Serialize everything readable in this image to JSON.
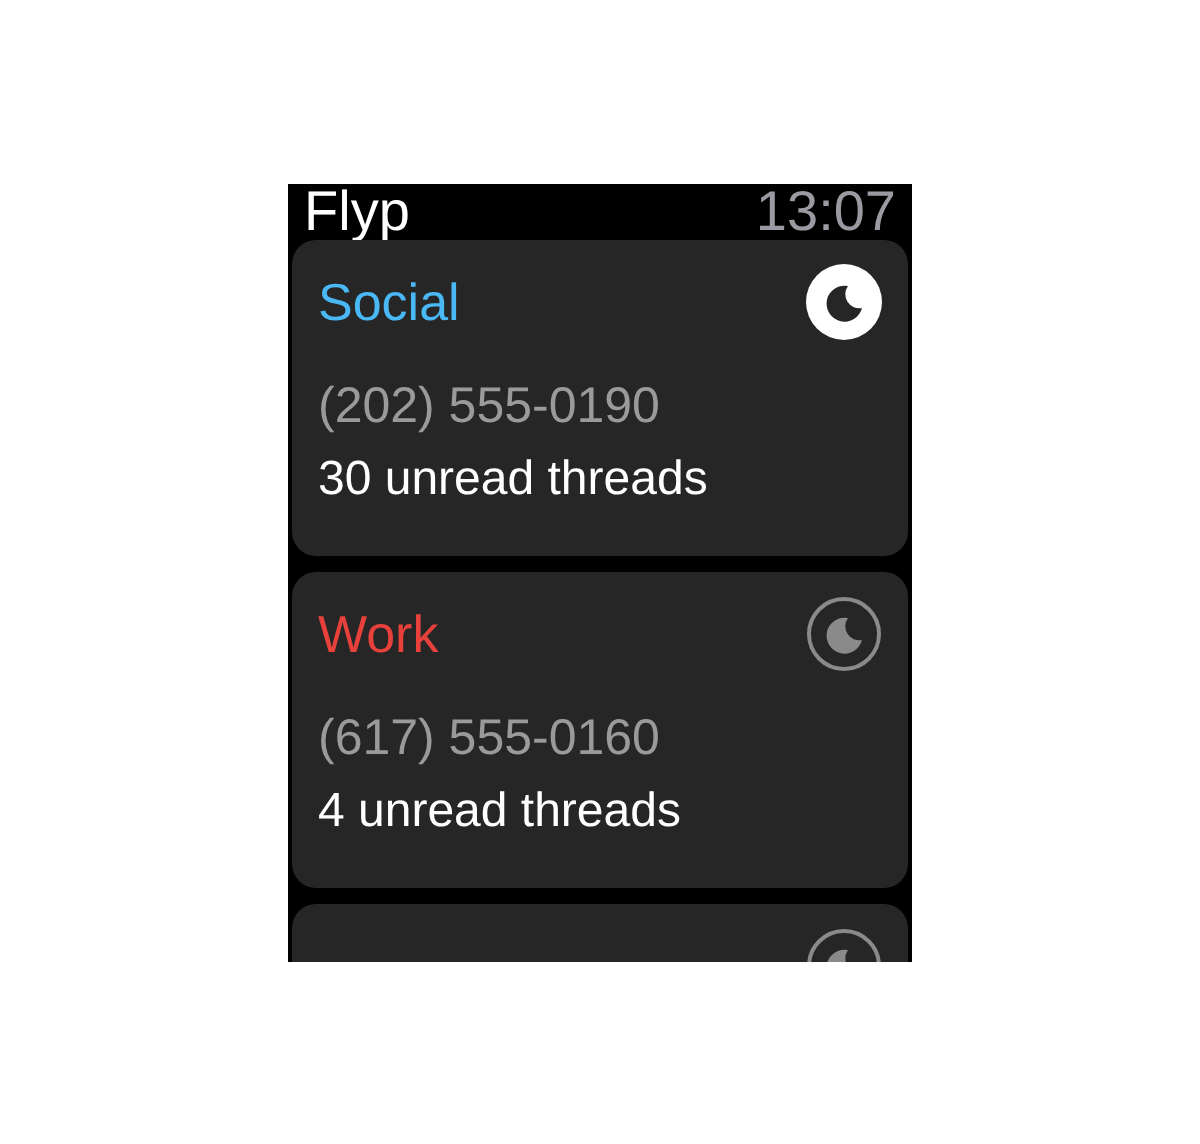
{
  "header": {
    "app_name": "Flyp",
    "time": "13:07"
  },
  "accounts": [
    {
      "name": "Social",
      "color": "#4ab8f5",
      "phone": "(202) 555-0190",
      "unread": "30 unread threads",
      "do_not_disturb": true
    },
    {
      "name": "Work",
      "color": "#e8413c",
      "phone": "(617) 555-0160",
      "unread": "4 unread threads",
      "do_not_disturb": false
    },
    {
      "do_not_disturb": false
    }
  ]
}
